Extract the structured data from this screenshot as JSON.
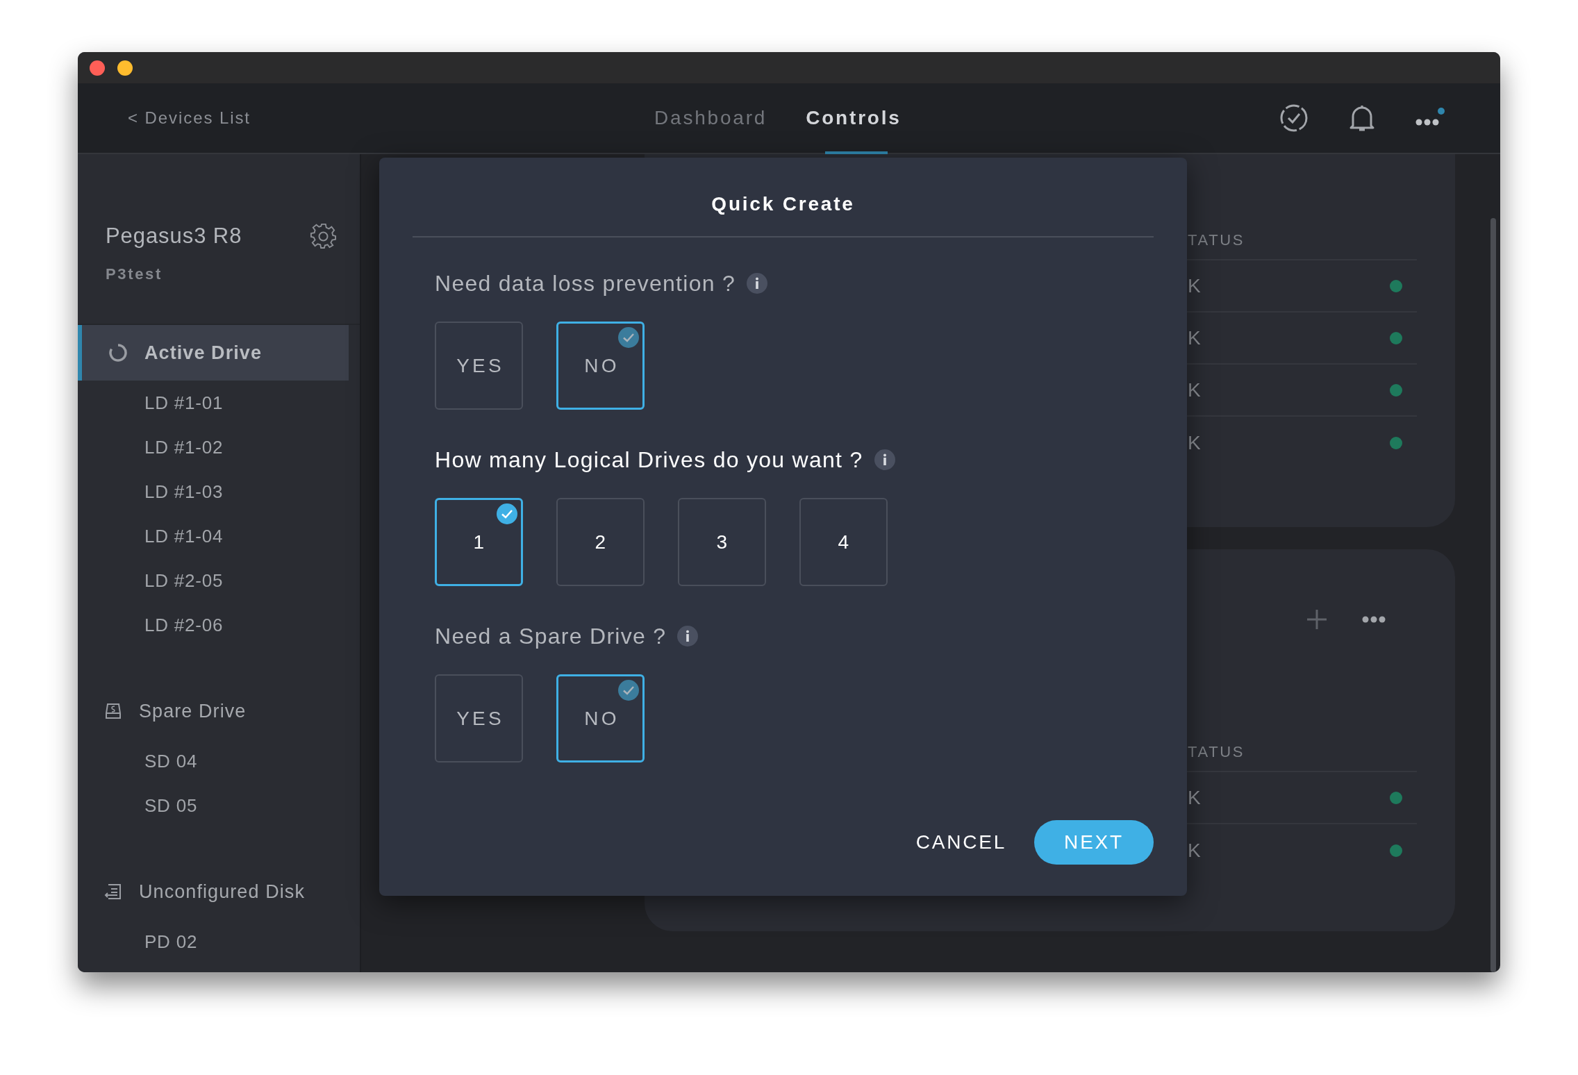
{
  "window": {
    "traffic_lights": [
      {
        "color": "#fe5f57"
      },
      {
        "color": "#febc2e"
      }
    ]
  },
  "header": {
    "back_link": "< Devices List",
    "tabs": [
      {
        "label": "Dashboard",
        "selected": false
      },
      {
        "label": "Controls",
        "selected": true
      }
    ],
    "more_has_notification": true
  },
  "sidebar": {
    "device_name": "Pegasus3 R8",
    "device_subtitle": "P3test",
    "sections": [
      {
        "kind": "active",
        "label": "Active Drive",
        "selected": true,
        "items": [
          "LD #1-01",
          "LD #1-02",
          "LD #1-03",
          "LD #1-04",
          "LD #2-05",
          "LD #2-06"
        ]
      },
      {
        "kind": "spare",
        "label": "Spare Drive",
        "selected": false,
        "items": [
          "SD 04",
          "SD 05"
        ]
      },
      {
        "kind": "unconfigured",
        "label": "Unconfigured Disk",
        "selected": false,
        "items": [
          "PD 02"
        ]
      }
    ]
  },
  "cards": [
    {
      "has_toolbar": false,
      "column_header": "TATUS",
      "rows": [
        {
          "cell": "K",
          "color": "#1e7a5c"
        },
        {
          "cell": "K",
          "color": "#1e7a5c"
        },
        {
          "cell": "K",
          "color": "#1e7a5c"
        },
        {
          "cell": "K",
          "color": "#1e7a5c"
        }
      ]
    },
    {
      "has_toolbar": true,
      "column_header": "TATUS",
      "rows": [
        {
          "cell": "K",
          "color": "#1e7a5c"
        },
        {
          "cell": "K",
          "color": "#1e7a5c"
        }
      ]
    }
  ],
  "dialog": {
    "title": "Quick Create",
    "questions": [
      {
        "text": "Need data loss prevention ?",
        "active": false,
        "options": [
          {
            "label": "YES",
            "selected": false
          },
          {
            "label": "NO",
            "selected": true
          }
        ]
      },
      {
        "text": "How many Logical Drives do you want ?",
        "active": true,
        "options": [
          {
            "label": "1",
            "selected": true
          },
          {
            "label": "2",
            "selected": false
          },
          {
            "label": "3",
            "selected": false
          },
          {
            "label": "4",
            "selected": false
          }
        ]
      },
      {
        "text": "Need a Spare Drive ?",
        "active": false,
        "options": [
          {
            "label": "YES",
            "selected": false
          },
          {
            "label": "NO",
            "selected": true
          }
        ]
      }
    ],
    "buttons": [
      {
        "label": "CANCEL",
        "kind": "text"
      },
      {
        "label": "NEXT",
        "kind": "primary"
      }
    ]
  }
}
